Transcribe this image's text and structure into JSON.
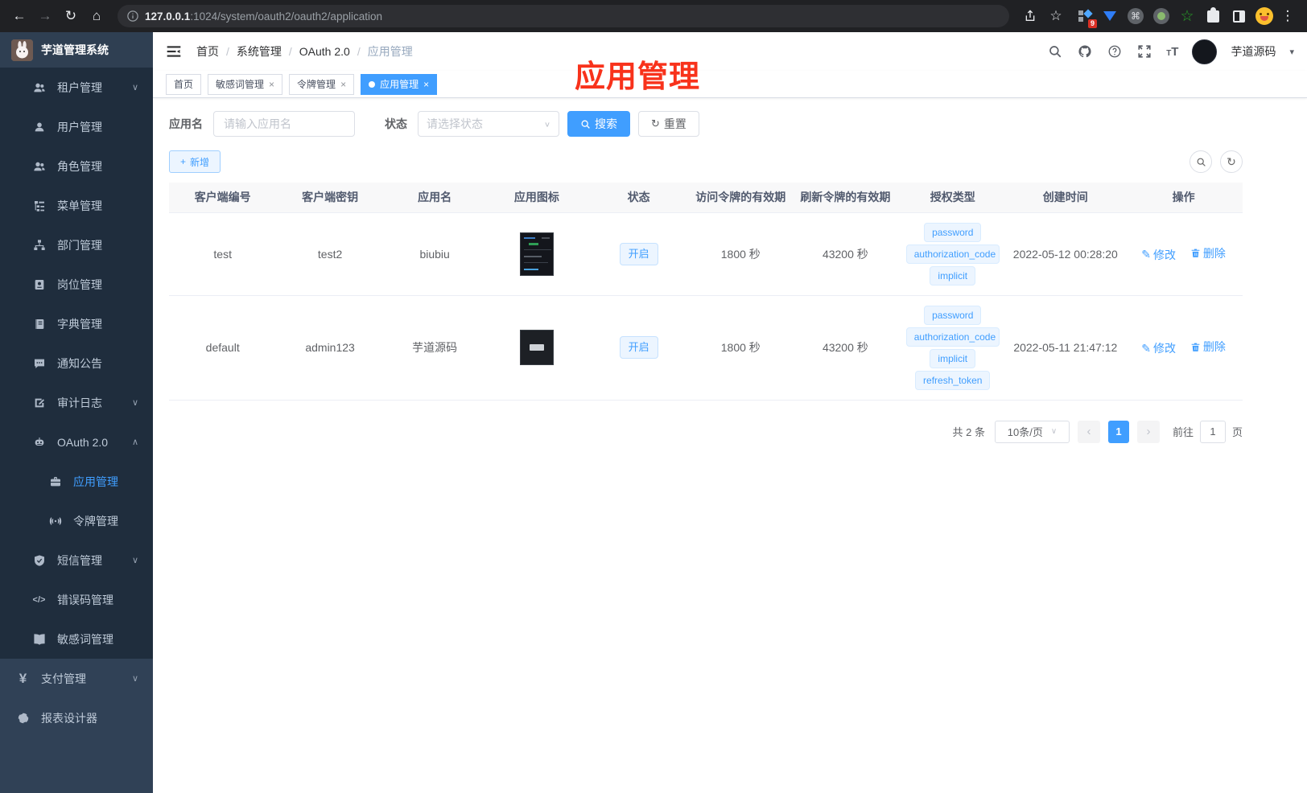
{
  "colors": {
    "accent": "#409eff",
    "annotation": "#f8321b",
    "sidebar_bg": "#304156",
    "submenu_bg": "#1f2d3d"
  },
  "icons": {
    "back": "←",
    "forward": "→",
    "reload": "↻",
    "home": "⌂",
    "star": "☆",
    "kebab": "⋮",
    "cmd": "⌘",
    "chev_down": "∨",
    "chev_up": "∧",
    "caret_down": "▾",
    "close": "×",
    "plus": "+",
    "edit_pen": "✎",
    "prev": "‹",
    "next": "›",
    "yen": "¥",
    "code": "</>",
    "refresh": "↻",
    "small_t": "T",
    "big_t": "T"
  },
  "browser": {
    "url_host": "127.0.0.1",
    "url_path": ":1024/system/oauth2/oauth2/application",
    "extension_badge": "9"
  },
  "sidebar": {
    "title": "芋道管理系统",
    "items": [
      {
        "label": "租户管理"
      },
      {
        "label": "用户管理"
      },
      {
        "label": "角色管理"
      },
      {
        "label": "菜单管理"
      },
      {
        "label": "部门管理"
      },
      {
        "label": "岗位管理"
      },
      {
        "label": "字典管理"
      },
      {
        "label": "通知公告"
      },
      {
        "label": "审计日志"
      },
      {
        "label": "OAuth 2.0"
      },
      {
        "label": "应用管理"
      },
      {
        "label": "令牌管理"
      },
      {
        "label": "短信管理"
      },
      {
        "label": "错误码管理"
      },
      {
        "label": "敏感词管理"
      },
      {
        "label": "支付管理"
      },
      {
        "label": "报表设计器"
      }
    ]
  },
  "header": {
    "breadcrumb": [
      "首页",
      "系统管理",
      "OAuth 2.0",
      "应用管理"
    ],
    "separator": "/",
    "username": "芋道源码"
  },
  "tabs": [
    {
      "label": "首页"
    },
    {
      "label": "敏感词管理"
    },
    {
      "label": "令牌管理"
    },
    {
      "label": "应用管理"
    }
  ],
  "annotation": {
    "text": "应用管理"
  },
  "filters": {
    "name_label": "应用名",
    "name_placeholder": "请输入应用名",
    "status_label": "状态",
    "status_placeholder": "请选择状态",
    "search_label": "搜索",
    "reset_label": "重置"
  },
  "toolbar": {
    "add_label": "新增"
  },
  "table": {
    "headers": [
      "客户端编号",
      "客户端密钥",
      "应用名",
      "应用图标",
      "状态",
      "访问令牌的有效期",
      "刷新令牌的有效期",
      "授权类型",
      "创建时间",
      "操作"
    ],
    "actions": {
      "edit": "修改",
      "delete": "删除"
    },
    "rows": [
      {
        "client_id": "test",
        "secret": "test2",
        "name": "biubiu",
        "status": "开启",
        "access_validity": "1800 秒",
        "refresh_validity": "43200 秒",
        "grants": [
          "password",
          "authorization_code",
          "implicit"
        ],
        "created": "2022-05-12 00:28:20"
      },
      {
        "client_id": "default",
        "secret": "admin123",
        "name": "芋道源码",
        "status": "开启",
        "access_validity": "1800 秒",
        "refresh_validity": "43200 秒",
        "grants": [
          "password",
          "authorization_code",
          "implicit",
          "refresh_token"
        ],
        "created": "2022-05-11 21:47:12"
      }
    ]
  },
  "pagination": {
    "total": "共 2 条",
    "page_size": "10条/页",
    "current_page": "1",
    "goto_label": "前往",
    "goto_value": "1",
    "page_unit": "页"
  }
}
